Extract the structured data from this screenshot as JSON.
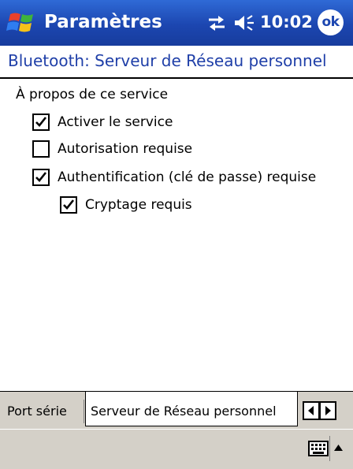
{
  "titlebar": {
    "app_title": "Paramètres",
    "clock": "10:02",
    "ok_label": "ok",
    "start_icon": "windows-flag-icon",
    "connectivity_icon": "connectivity-arrows-icon",
    "volume_icon": "speaker-icon",
    "color": "#1c46b0"
  },
  "page": {
    "heading": "Bluetooth: Serveur de Réseau personnel",
    "heading_color": "#1f3fa8"
  },
  "content": {
    "section_label": "À propos de ce service",
    "options": [
      {
        "label": "Activer le service",
        "checked": true
      },
      {
        "label": "Autorisation requise",
        "checked": false
      },
      {
        "label": "Authentification (clé de passe) requise",
        "checked": true
      },
      {
        "label": "Cryptage requis",
        "checked": true
      }
    ]
  },
  "tabs": {
    "items": [
      {
        "label": "Port série",
        "active": false
      },
      {
        "label": "Serveur de Réseau personnel",
        "active": true
      }
    ],
    "scroll_left_icon": "arrow-left-icon",
    "scroll_right_icon": "arrow-right-icon"
  },
  "command_bar": {
    "keyboard_icon": "keyboard-icon",
    "sip_arrow_icon": "caret-up-icon",
    "background": "#d4d0c8"
  }
}
